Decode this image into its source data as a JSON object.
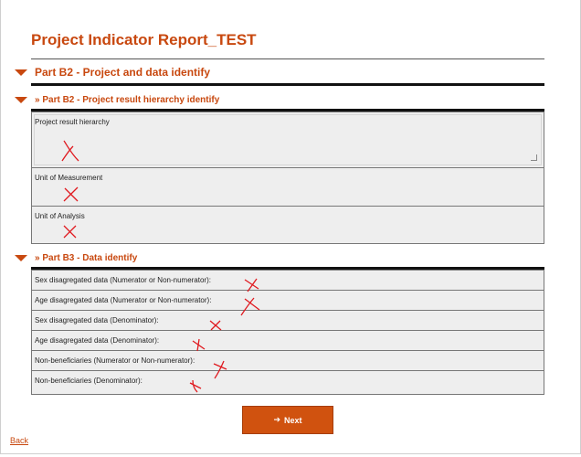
{
  "page": {
    "title": "Project Indicator Report_TEST"
  },
  "partB2": {
    "heading": "Part B2 - Project and data identify",
    "subheading": "» Part B2 - Project result hierarchy identify",
    "fields": [
      {
        "label": "Project result hierarchy"
      },
      {
        "label": "Unit of Measurement"
      },
      {
        "label": "Unit of Analysis"
      }
    ]
  },
  "partB3": {
    "heading": "» Part B3 - Data identify",
    "rows": [
      {
        "label": "Sex disagregated data (Numerator or Non-numerator):"
      },
      {
        "label": "Age disagregated data (Numerator or Non-numerator):"
      },
      {
        "label": "Sex disagregated data (Denominator):"
      },
      {
        "label": "Age disagregated data (Denominator):"
      },
      {
        "label": "Non-beneficiaries (Numerator or Non-numerator):"
      },
      {
        "label": "Non-beneficiaries (Denominator):"
      }
    ]
  },
  "actions": {
    "next_label": "Next",
    "back_label": "Back"
  },
  "colors": {
    "accent": "#c8480f",
    "button": "#d0520f",
    "annotation": "#e0191f"
  }
}
